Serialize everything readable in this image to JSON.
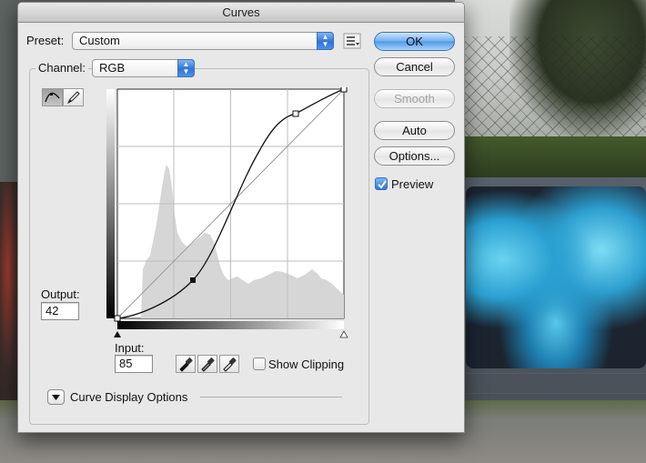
{
  "window": {
    "title": "Curves"
  },
  "preset": {
    "label": "Preset:",
    "value": "Custom"
  },
  "channel": {
    "label": "Channel:",
    "value": "RGB"
  },
  "buttons": {
    "ok": "OK",
    "cancel": "Cancel",
    "smooth": "Smooth",
    "auto": "Auto",
    "options": "Options..."
  },
  "preview": {
    "label": "Preview",
    "checked": true
  },
  "output": {
    "label": "Output:",
    "value": "42"
  },
  "input": {
    "label": "Input:",
    "value": "85"
  },
  "show_clipping": {
    "label": "Show Clipping",
    "checked": false
  },
  "curve_display_options": {
    "label": "Curve Display Options"
  },
  "curve": {
    "control_points": [
      [
        0,
        0
      ],
      [
        85,
        42
      ],
      [
        185,
        215
      ],
      [
        255,
        255
      ]
    ],
    "selected_point": [
      85,
      42
    ]
  },
  "icons": {
    "curve_tool": "curve-tool-icon",
    "pencil_tool": "pencil-tool-icon",
    "preset_options": "preset-options-icon",
    "black_eyedropper": "eyedropper-black-icon",
    "gray_eyedropper": "eyedropper-gray-icon",
    "white_eyedropper": "eyedropper-white-icon",
    "disclosure": "disclosure-triangle-icon"
  },
  "colors": {
    "default_button": "#4f98e8",
    "histogram": "#d6d6d6"
  }
}
